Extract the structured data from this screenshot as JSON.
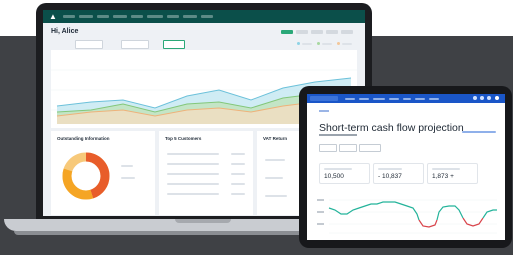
{
  "laptop": {
    "greeting": "Hi, Alice",
    "cards": [
      {
        "title": "Outstanding Information"
      },
      {
        "title": "Top 5 Customers"
      },
      {
        "title": "VAT Return"
      }
    ],
    "chart_series_colors": [
      "#8ed3e6",
      "#a8d8a0",
      "#f3c79a"
    ]
  },
  "tablet": {
    "nav_chip": "",
    "title": "Short-term cash flow projection",
    "cards": [
      {
        "value": "10,500"
      },
      {
        "value": "- 10,837"
      },
      {
        "value": "1,873 +"
      }
    ],
    "colors": {
      "accent": "#1a56c8",
      "positive": "#23b39a",
      "negative": "#d9434a"
    }
  },
  "donut": {
    "segments": [
      {
        "color": "#e85d2a",
        "fraction": 0.45
      },
      {
        "color": "#f5a524",
        "fraction": 0.35
      },
      {
        "color": "#f7c97a",
        "fraction": 0.2
      }
    ]
  }
}
